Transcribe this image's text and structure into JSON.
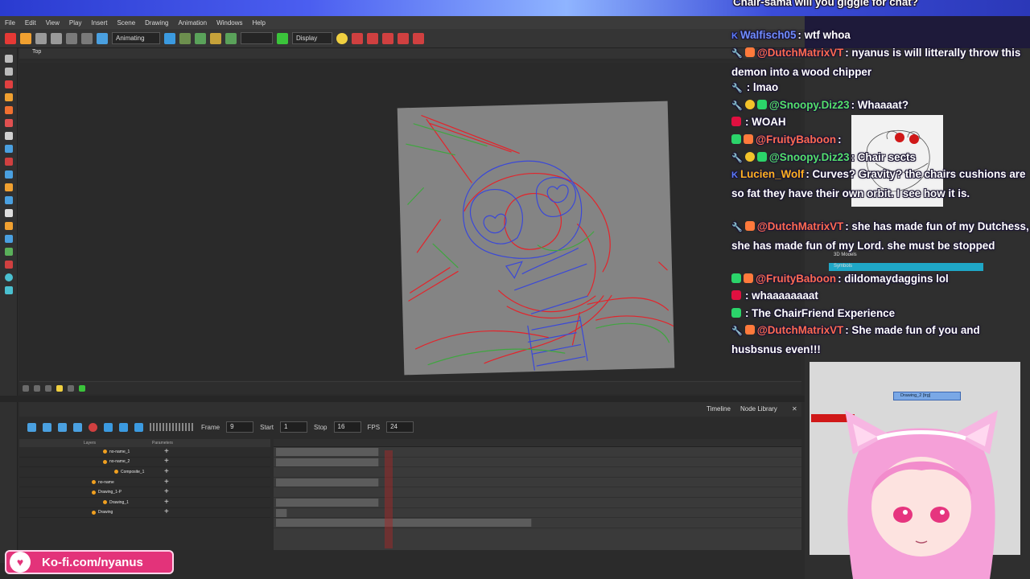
{
  "menu": [
    "File",
    "Edit",
    "View",
    "Play",
    "Insert",
    "Scene",
    "Drawing",
    "Animation",
    "Windows",
    "Help"
  ],
  "toolbar": {
    "mode": "Animating",
    "display": "Display"
  },
  "view": {
    "title": "Top"
  },
  "timeline": {
    "tabs": [
      "Timeline",
      "Node Library"
    ],
    "frame_label": "Frame",
    "frame_value": "9",
    "start_label": "Start",
    "start_value": "1",
    "stop_label": "Stop",
    "stop_value": "16",
    "fps_label": "FPS",
    "fps_value": "24",
    "header_layers": "Layers",
    "header_params": "Parameters",
    "layers": [
      "no-name_1",
      "no-name_2",
      "Composite_1",
      "no-name",
      "Drawing_1-P",
      "Drawing_1",
      "Drawing"
    ]
  },
  "nodes": {
    "drawing2": "Drawing_2 [trg]",
    "panel_top": "Top"
  },
  "library": {
    "item1": "3D Models",
    "item2": "Symbols"
  },
  "chat": [
    {
      "user": "",
      "text": "Chair-sama will you giggle for chat?",
      "color": "#ffffff",
      "badges": []
    },
    {
      "user": "Walfisch05",
      "text": ": wtf whoa",
      "color": "#6f8cff",
      "badges": [
        "K"
      ]
    },
    {
      "user": "@DutchMatrixVT",
      "text": ": nyanus is will litterally throw this demon into a wood chipper",
      "color": "#ff6a50",
      "badges": [
        "wrench",
        "gift"
      ]
    },
    {
      "user": "",
      "text": ": lmao",
      "color": "#ffffff",
      "badges": [
        "wrench"
      ]
    },
    {
      "user": "@Snoopy.Diz23",
      "text": ": Whaaaat?",
      "color": "#54e06a",
      "badges": [
        "wrench",
        "star",
        "sub"
      ]
    },
    {
      "user": "",
      "text": ": WOAH",
      "color": "#ffffff",
      "badges": [
        "red"
      ]
    },
    {
      "user": "@FruityBaboon",
      "text": ":",
      "color": "#ff6a50",
      "badges": [
        "sub",
        "gift"
      ]
    },
    {
      "user": "@Snoopy.Diz23",
      "text": ": Chair sects",
      "color": "#54e06a",
      "badges": [
        "wrench",
        "star",
        "sub"
      ]
    },
    {
      "user": "Lucien_Wolf",
      "text": ": Curves? Gravity? the chairs cushions are so fat they have their own orbit. I see how it is.",
      "color": "#ffb020",
      "badges": [
        "K"
      ]
    },
    {
      "user": "@DutchMatrixVT",
      "text": ": she has made fun of my Dutchess, she has made fun of my Lord. she must be stopped",
      "color": "#ff6a50",
      "badges": [
        "wrench",
        "gift"
      ]
    },
    {
      "user": "@FruityBaboon",
      "text": ": dildomaydaggins lol",
      "color": "#ff6a50",
      "badges": [
        "sub",
        "gift"
      ]
    },
    {
      "user": "",
      "text": ": whaaaaaaaat",
      "color": "#ffffff",
      "badges": [
        "red"
      ]
    },
    {
      "user": "",
      "text": ": The ChairFriend Experience",
      "color": "#ffffff",
      "badges": [
        "sub"
      ]
    },
    {
      "user": "@DutchMatrixVT",
      "text": ": She made fun of you and husbsnus even!!!",
      "color": "#ff6a50",
      "badges": [
        "wrench",
        "gift"
      ]
    }
  ],
  "kofi": {
    "label": "Ko-fi.com/nyanus"
  },
  "colors": {
    "accent_red": "#d01818",
    "sketch_red": "#e3242b",
    "sketch_blue": "#3a48d8",
    "sketch_green": "#3fa63f",
    "kofi_pink": "#e3337a"
  }
}
